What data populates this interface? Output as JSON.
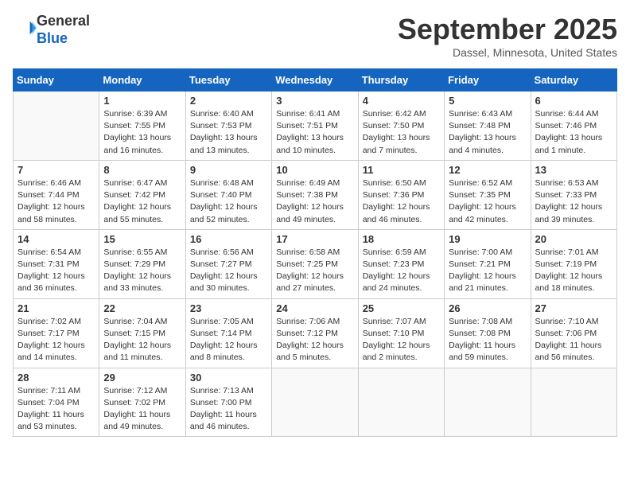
{
  "header": {
    "logo_line1": "General",
    "logo_line2": "Blue",
    "month": "September 2025",
    "location": "Dassel, Minnesota, United States"
  },
  "days_of_week": [
    "Sunday",
    "Monday",
    "Tuesday",
    "Wednesday",
    "Thursday",
    "Friday",
    "Saturday"
  ],
  "weeks": [
    [
      {
        "day": "",
        "info": ""
      },
      {
        "day": "1",
        "info": "Sunrise: 6:39 AM\nSunset: 7:55 PM\nDaylight: 13 hours\nand 16 minutes."
      },
      {
        "day": "2",
        "info": "Sunrise: 6:40 AM\nSunset: 7:53 PM\nDaylight: 13 hours\nand 13 minutes."
      },
      {
        "day": "3",
        "info": "Sunrise: 6:41 AM\nSunset: 7:51 PM\nDaylight: 13 hours\nand 10 minutes."
      },
      {
        "day": "4",
        "info": "Sunrise: 6:42 AM\nSunset: 7:50 PM\nDaylight: 13 hours\nand 7 minutes."
      },
      {
        "day": "5",
        "info": "Sunrise: 6:43 AM\nSunset: 7:48 PM\nDaylight: 13 hours\nand 4 minutes."
      },
      {
        "day": "6",
        "info": "Sunrise: 6:44 AM\nSunset: 7:46 PM\nDaylight: 13 hours\nand 1 minute."
      }
    ],
    [
      {
        "day": "7",
        "info": "Sunrise: 6:46 AM\nSunset: 7:44 PM\nDaylight: 12 hours\nand 58 minutes."
      },
      {
        "day": "8",
        "info": "Sunrise: 6:47 AM\nSunset: 7:42 PM\nDaylight: 12 hours\nand 55 minutes."
      },
      {
        "day": "9",
        "info": "Sunrise: 6:48 AM\nSunset: 7:40 PM\nDaylight: 12 hours\nand 52 minutes."
      },
      {
        "day": "10",
        "info": "Sunrise: 6:49 AM\nSunset: 7:38 PM\nDaylight: 12 hours\nand 49 minutes."
      },
      {
        "day": "11",
        "info": "Sunrise: 6:50 AM\nSunset: 7:36 PM\nDaylight: 12 hours\nand 46 minutes."
      },
      {
        "day": "12",
        "info": "Sunrise: 6:52 AM\nSunset: 7:35 PM\nDaylight: 12 hours\nand 42 minutes."
      },
      {
        "day": "13",
        "info": "Sunrise: 6:53 AM\nSunset: 7:33 PM\nDaylight: 12 hours\nand 39 minutes."
      }
    ],
    [
      {
        "day": "14",
        "info": "Sunrise: 6:54 AM\nSunset: 7:31 PM\nDaylight: 12 hours\nand 36 minutes."
      },
      {
        "day": "15",
        "info": "Sunrise: 6:55 AM\nSunset: 7:29 PM\nDaylight: 12 hours\nand 33 minutes."
      },
      {
        "day": "16",
        "info": "Sunrise: 6:56 AM\nSunset: 7:27 PM\nDaylight: 12 hours\nand 30 minutes."
      },
      {
        "day": "17",
        "info": "Sunrise: 6:58 AM\nSunset: 7:25 PM\nDaylight: 12 hours\nand 27 minutes."
      },
      {
        "day": "18",
        "info": "Sunrise: 6:59 AM\nSunset: 7:23 PM\nDaylight: 12 hours\nand 24 minutes."
      },
      {
        "day": "19",
        "info": "Sunrise: 7:00 AM\nSunset: 7:21 PM\nDaylight: 12 hours\nand 21 minutes."
      },
      {
        "day": "20",
        "info": "Sunrise: 7:01 AM\nSunset: 7:19 PM\nDaylight: 12 hours\nand 18 minutes."
      }
    ],
    [
      {
        "day": "21",
        "info": "Sunrise: 7:02 AM\nSunset: 7:17 PM\nDaylight: 12 hours\nand 14 minutes."
      },
      {
        "day": "22",
        "info": "Sunrise: 7:04 AM\nSunset: 7:15 PM\nDaylight: 12 hours\nand 11 minutes."
      },
      {
        "day": "23",
        "info": "Sunrise: 7:05 AM\nSunset: 7:14 PM\nDaylight: 12 hours\nand 8 minutes."
      },
      {
        "day": "24",
        "info": "Sunrise: 7:06 AM\nSunset: 7:12 PM\nDaylight: 12 hours\nand 5 minutes."
      },
      {
        "day": "25",
        "info": "Sunrise: 7:07 AM\nSunset: 7:10 PM\nDaylight: 12 hours\nand 2 minutes."
      },
      {
        "day": "26",
        "info": "Sunrise: 7:08 AM\nSunset: 7:08 PM\nDaylight: 11 hours\nand 59 minutes."
      },
      {
        "day": "27",
        "info": "Sunrise: 7:10 AM\nSunset: 7:06 PM\nDaylight: 11 hours\nand 56 minutes."
      }
    ],
    [
      {
        "day": "28",
        "info": "Sunrise: 7:11 AM\nSunset: 7:04 PM\nDaylight: 11 hours\nand 53 minutes."
      },
      {
        "day": "29",
        "info": "Sunrise: 7:12 AM\nSunset: 7:02 PM\nDaylight: 11 hours\nand 49 minutes."
      },
      {
        "day": "30",
        "info": "Sunrise: 7:13 AM\nSunset: 7:00 PM\nDaylight: 11 hours\nand 46 minutes."
      },
      {
        "day": "",
        "info": ""
      },
      {
        "day": "",
        "info": ""
      },
      {
        "day": "",
        "info": ""
      },
      {
        "day": "",
        "info": ""
      }
    ]
  ]
}
